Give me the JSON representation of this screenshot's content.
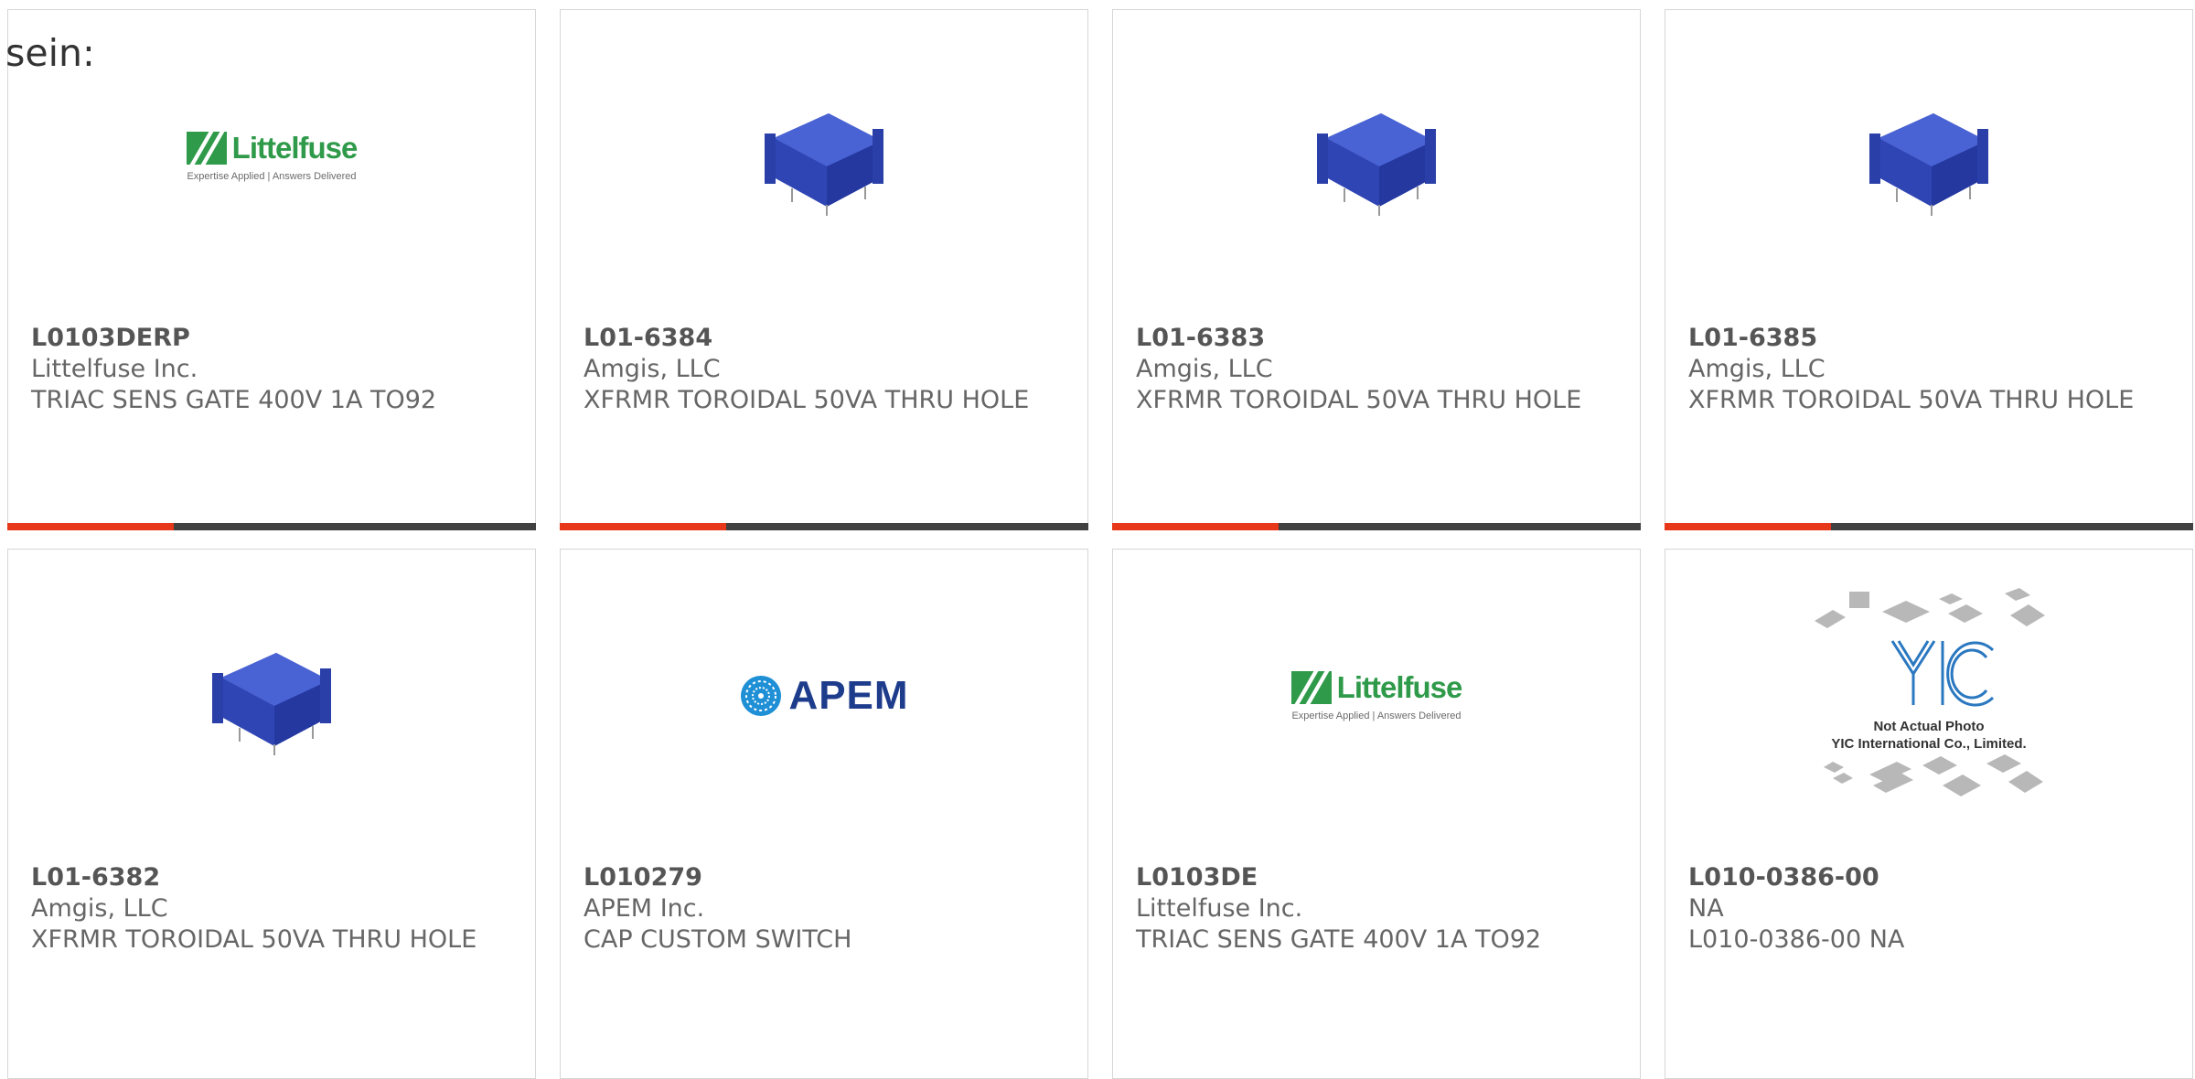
{
  "heading": "sein:",
  "colors": {
    "accent_red": "#e8381a",
    "accent_dark": "#414141",
    "littelfuse_green": "#2f9a4a",
    "apem_blue": "#1e3c8c",
    "xfmr_blue": "#2f45b4"
  },
  "cards": [
    {
      "part": "L0103DERP",
      "maker": "Littelfuse Inc.",
      "desc": "TRIAC SENS GATE 400V 1A TO92",
      "image": "littelfuse-logo",
      "logo": {
        "name": "Littelfuse",
        "tagline": "Expertise Applied | Answers Delivered"
      }
    },
    {
      "part": "L01-6384",
      "maker": "Amgis, LLC",
      "desc": "XFRMR TOROIDAL 50VA THRU HOLE",
      "image": "transformer-photo"
    },
    {
      "part": "L01-6383",
      "maker": "Amgis, LLC",
      "desc": "XFRMR TOROIDAL 50VA THRU HOLE",
      "image": "transformer-photo"
    },
    {
      "part": "L01-6385",
      "maker": "Amgis, LLC",
      "desc": "XFRMR TOROIDAL 50VA THRU HOLE",
      "image": "transformer-photo"
    },
    {
      "part": "L01-6382",
      "maker": "Amgis, LLC",
      "desc": "XFRMR TOROIDAL 50VA THRU HOLE",
      "image": "transformer-photo"
    },
    {
      "part": "L010279",
      "maker": "APEM Inc.",
      "desc": "CAP CUSTOM SWITCH",
      "image": "apem-logo",
      "logo": {
        "name": "APEM"
      }
    },
    {
      "part": "L0103DE",
      "maker": "Littelfuse Inc.",
      "desc": "TRIAC SENS GATE 400V 1A TO92",
      "image": "littelfuse-logo",
      "logo": {
        "name": "Littelfuse",
        "tagline": "Expertise Applied | Answers Delivered"
      }
    },
    {
      "part": "L010-0386-00",
      "maker": "NA",
      "desc": "L010-0386-00 NA",
      "image": "not-actual-photo-placeholder",
      "logo": {
        "line1": "Not Actual Photo",
        "line2": "YIC International Co., Limited."
      }
    }
  ]
}
